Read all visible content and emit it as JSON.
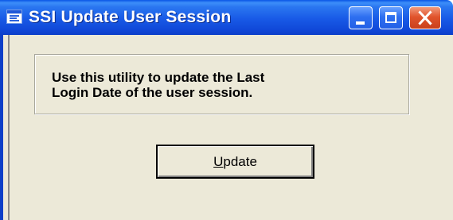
{
  "window": {
    "title": "SSI Update User Session",
    "controls": {
      "minimize": "minimize-icon",
      "maximize": "maximize-icon",
      "close": "close-icon"
    }
  },
  "content": {
    "info_text": "Use this utility to update the Last\nLogin Date of the user session.",
    "update_button": {
      "mnemonic": "U",
      "rest": "pdate"
    }
  },
  "colors": {
    "titlebar": "#1859e6",
    "window_bg": "#ece9d8",
    "close_button": "#e1542c"
  }
}
